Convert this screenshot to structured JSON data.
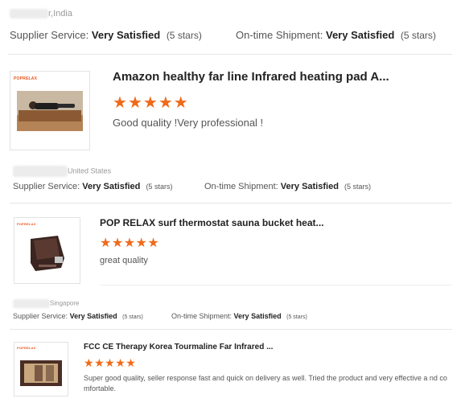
{
  "reviews": [
    {
      "country": "r,India",
      "supplier_label": "Supplier Service:",
      "supplier_value": "Very Satisfied",
      "supplier_stars": "(5 stars)",
      "shipment_label": "On-time Shipment:",
      "shipment_value": "Very Satisfied",
      "shipment_stars": "(5 stars)",
      "brand": "POPRELAX",
      "product_title": "Amazon healthy far line Infrared heating pad A...",
      "rating": 5,
      "comment": "Good quality !Very professional !"
    },
    {
      "country": "United States",
      "supplier_label": "Supplier Service:",
      "supplier_value": "Very Satisfied",
      "supplier_stars": "(5 stars)",
      "shipment_label": "On-time Shipment:",
      "shipment_value": "Very Satisfied",
      "shipment_stars": "(5 stars)",
      "brand": "POPRELAX",
      "product_title": "POP RELAX surf thermostat sauna bucket heat...",
      "rating": 5,
      "comment": "great quality"
    },
    {
      "country": "Singapore",
      "supplier_label": "Supplier Service:",
      "supplier_value": "Very Satisfied",
      "supplier_stars": "(5 stars)",
      "shipment_label": "On-time Shipment:",
      "shipment_value": "Very Satisfied",
      "shipment_stars": "(5 stars)",
      "brand": "POPRELAX",
      "product_title": "FCC CE Therapy Korea Tourmaline Far Infrared ...",
      "rating": 5,
      "comment": "Super good quality, seller response fast and quick on delivery as well. Tried the product and very effective a nd comfortable."
    }
  ],
  "icons": {
    "star": "star-icon"
  },
  "colors": {
    "star": "#f06a1a",
    "brand": "#e8541c"
  }
}
